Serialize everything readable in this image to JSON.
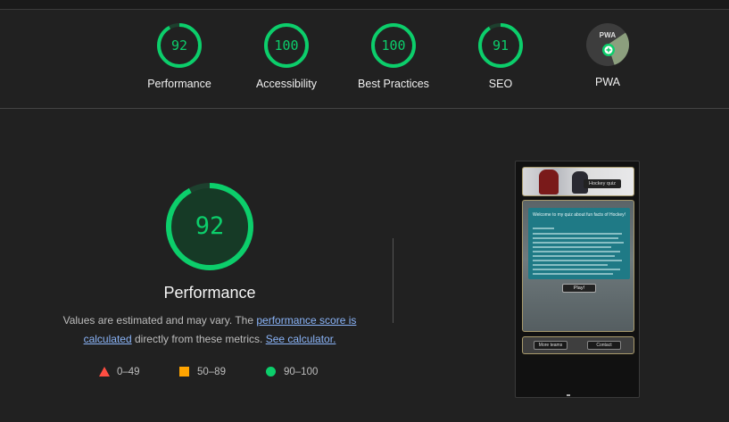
{
  "categories": [
    {
      "label": "Performance",
      "score": "92",
      "value": 92
    },
    {
      "label": "Accessibility",
      "score": "100",
      "value": 100
    },
    {
      "label": "Best Practices",
      "score": "100",
      "value": 100
    },
    {
      "label": "SEO",
      "score": "91",
      "value": 91
    }
  ],
  "pwa": {
    "label": "PWA",
    "badge_text": "PWA"
  },
  "main": {
    "score": "92",
    "value": 92,
    "title": "Performance",
    "desc_prefix": "Values are estimated and may vary. The ",
    "desc_link1": "performance score is calculated",
    "desc_middle": " directly from these metrics. ",
    "desc_link2": "See calculator."
  },
  "legend": [
    {
      "range": "0–49",
      "color": "#ff4e42",
      "shape": "triangle"
    },
    {
      "range": "50–89",
      "color": "#ffa400",
      "shape": "square"
    },
    {
      "range": "90–100",
      "color": "#0cce6b",
      "shape": "circle"
    }
  ],
  "colors": {
    "pass": "#0cce6b",
    "link": "#8ab4f8",
    "background": "#212121"
  },
  "screenshot": {
    "header_button": "Hockey quiz",
    "card_title": "Welcome to my quiz about fun facts of Hockey!",
    "play_button": "Play!",
    "footer_left_button": "More teams",
    "footer_right_button": "Contact"
  }
}
